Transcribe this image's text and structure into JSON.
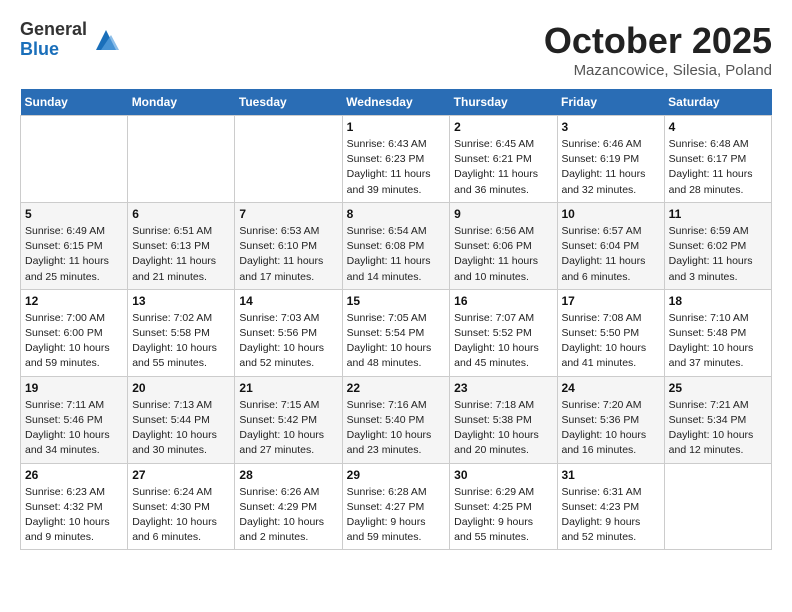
{
  "logo": {
    "general": "General",
    "blue": "Blue"
  },
  "title": {
    "month": "October 2025",
    "subtitle": "Mazancowice, Silesia, Poland"
  },
  "headers": [
    "Sunday",
    "Monday",
    "Tuesday",
    "Wednesday",
    "Thursday",
    "Friday",
    "Saturday"
  ],
  "weeks": [
    [
      {
        "day": "",
        "info": ""
      },
      {
        "day": "",
        "info": ""
      },
      {
        "day": "",
        "info": ""
      },
      {
        "day": "1",
        "info": "Sunrise: 6:43 AM\nSunset: 6:23 PM\nDaylight: 11 hours\nand 39 minutes."
      },
      {
        "day": "2",
        "info": "Sunrise: 6:45 AM\nSunset: 6:21 PM\nDaylight: 11 hours\nand 36 minutes."
      },
      {
        "day": "3",
        "info": "Sunrise: 6:46 AM\nSunset: 6:19 PM\nDaylight: 11 hours\nand 32 minutes."
      },
      {
        "day": "4",
        "info": "Sunrise: 6:48 AM\nSunset: 6:17 PM\nDaylight: 11 hours\nand 28 minutes."
      }
    ],
    [
      {
        "day": "5",
        "info": "Sunrise: 6:49 AM\nSunset: 6:15 PM\nDaylight: 11 hours\nand 25 minutes."
      },
      {
        "day": "6",
        "info": "Sunrise: 6:51 AM\nSunset: 6:13 PM\nDaylight: 11 hours\nand 21 minutes."
      },
      {
        "day": "7",
        "info": "Sunrise: 6:53 AM\nSunset: 6:10 PM\nDaylight: 11 hours\nand 17 minutes."
      },
      {
        "day": "8",
        "info": "Sunrise: 6:54 AM\nSunset: 6:08 PM\nDaylight: 11 hours\nand 14 minutes."
      },
      {
        "day": "9",
        "info": "Sunrise: 6:56 AM\nSunset: 6:06 PM\nDaylight: 11 hours\nand 10 minutes."
      },
      {
        "day": "10",
        "info": "Sunrise: 6:57 AM\nSunset: 6:04 PM\nDaylight: 11 hours\nand 6 minutes."
      },
      {
        "day": "11",
        "info": "Sunrise: 6:59 AM\nSunset: 6:02 PM\nDaylight: 11 hours\nand 3 minutes."
      }
    ],
    [
      {
        "day": "12",
        "info": "Sunrise: 7:00 AM\nSunset: 6:00 PM\nDaylight: 10 hours\nand 59 minutes."
      },
      {
        "day": "13",
        "info": "Sunrise: 7:02 AM\nSunset: 5:58 PM\nDaylight: 10 hours\nand 55 minutes."
      },
      {
        "day": "14",
        "info": "Sunrise: 7:03 AM\nSunset: 5:56 PM\nDaylight: 10 hours\nand 52 minutes."
      },
      {
        "day": "15",
        "info": "Sunrise: 7:05 AM\nSunset: 5:54 PM\nDaylight: 10 hours\nand 48 minutes."
      },
      {
        "day": "16",
        "info": "Sunrise: 7:07 AM\nSunset: 5:52 PM\nDaylight: 10 hours\nand 45 minutes."
      },
      {
        "day": "17",
        "info": "Sunrise: 7:08 AM\nSunset: 5:50 PM\nDaylight: 10 hours\nand 41 minutes."
      },
      {
        "day": "18",
        "info": "Sunrise: 7:10 AM\nSunset: 5:48 PM\nDaylight: 10 hours\nand 37 minutes."
      }
    ],
    [
      {
        "day": "19",
        "info": "Sunrise: 7:11 AM\nSunset: 5:46 PM\nDaylight: 10 hours\nand 34 minutes."
      },
      {
        "day": "20",
        "info": "Sunrise: 7:13 AM\nSunset: 5:44 PM\nDaylight: 10 hours\nand 30 minutes."
      },
      {
        "day": "21",
        "info": "Sunrise: 7:15 AM\nSunset: 5:42 PM\nDaylight: 10 hours\nand 27 minutes."
      },
      {
        "day": "22",
        "info": "Sunrise: 7:16 AM\nSunset: 5:40 PM\nDaylight: 10 hours\nand 23 minutes."
      },
      {
        "day": "23",
        "info": "Sunrise: 7:18 AM\nSunset: 5:38 PM\nDaylight: 10 hours\nand 20 minutes."
      },
      {
        "day": "24",
        "info": "Sunrise: 7:20 AM\nSunset: 5:36 PM\nDaylight: 10 hours\nand 16 minutes."
      },
      {
        "day": "25",
        "info": "Sunrise: 7:21 AM\nSunset: 5:34 PM\nDaylight: 10 hours\nand 12 minutes."
      }
    ],
    [
      {
        "day": "26",
        "info": "Sunrise: 6:23 AM\nSunset: 4:32 PM\nDaylight: 10 hours\nand 9 minutes."
      },
      {
        "day": "27",
        "info": "Sunrise: 6:24 AM\nSunset: 4:30 PM\nDaylight: 10 hours\nand 6 minutes."
      },
      {
        "day": "28",
        "info": "Sunrise: 6:26 AM\nSunset: 4:29 PM\nDaylight: 10 hours\nand 2 minutes."
      },
      {
        "day": "29",
        "info": "Sunrise: 6:28 AM\nSunset: 4:27 PM\nDaylight: 9 hours\nand 59 minutes."
      },
      {
        "day": "30",
        "info": "Sunrise: 6:29 AM\nSunset: 4:25 PM\nDaylight: 9 hours\nand 55 minutes."
      },
      {
        "day": "31",
        "info": "Sunrise: 6:31 AM\nSunset: 4:23 PM\nDaylight: 9 hours\nand 52 minutes."
      },
      {
        "day": "",
        "info": ""
      }
    ]
  ]
}
